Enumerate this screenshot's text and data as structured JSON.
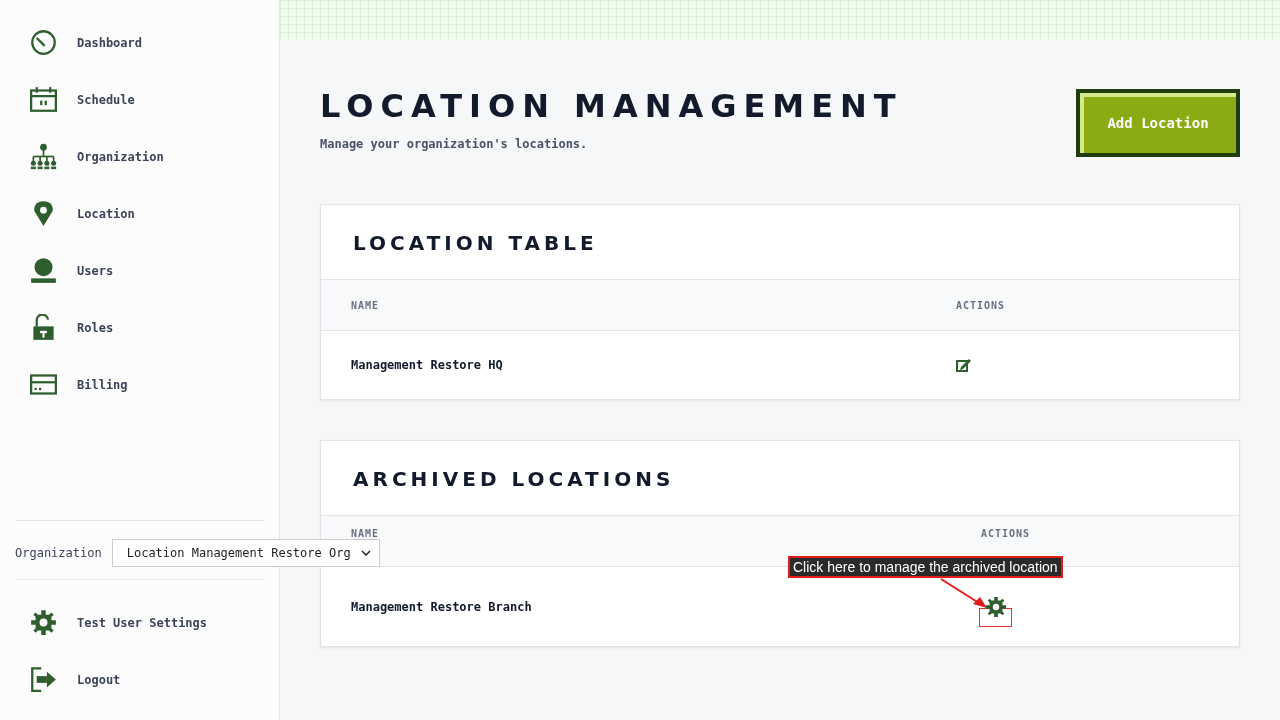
{
  "sidebar": {
    "items": [
      {
        "label": "Dashboard"
      },
      {
        "label": "Schedule"
      },
      {
        "label": "Organization"
      },
      {
        "label": "Location"
      },
      {
        "label": "Users"
      },
      {
        "label": "Roles"
      },
      {
        "label": "Billing"
      }
    ],
    "org_selector": {
      "label": "Organization",
      "value": "Location Management Restore Org"
    },
    "footer_items": [
      {
        "label": "Test User Settings"
      },
      {
        "label": "Logout"
      }
    ]
  },
  "page": {
    "title": "LOCATION MANAGEMENT",
    "subtitle": "Manage your organization's locations.",
    "add_button": "Add Location"
  },
  "tables": [
    {
      "title": "LOCATION TABLE",
      "columns": [
        "NAME",
        "ACTIONS"
      ],
      "rows": [
        {
          "name": "Management Restore HQ"
        }
      ]
    },
    {
      "title": "ARCHIVED LOCATIONS",
      "columns": [
        "NAME",
        "ACTIONS"
      ],
      "rows": [
        {
          "name": "Management Restore Branch"
        }
      ]
    }
  ],
  "annotation": {
    "text": "Click here to manage the archived location"
  }
}
